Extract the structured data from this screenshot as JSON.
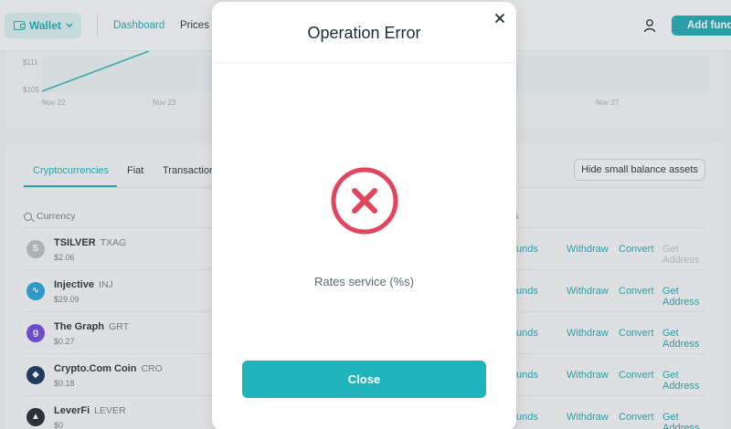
{
  "header": {
    "wallet_label": "Wallet",
    "nav": {
      "dashboard": "Dashboard",
      "prices": "Prices"
    },
    "add_funds_label": "Add funds"
  },
  "chart": {
    "y_labels": [
      "$111",
      "$105"
    ],
    "x_labels": [
      "Nov 22",
      "Nov 23",
      "Nov 27"
    ]
  },
  "assets": {
    "tabs": [
      "Cryptocurrencies",
      "Fiat",
      "Transaction"
    ],
    "hide_small_label": "Hide small balance assets",
    "currency_header": "Currency",
    "actions_header": "s",
    "rows": [
      {
        "name": "TSILVER",
        "symbol": "TXAG",
        "price": "$2.06",
        "icon_color": "#b9bdbf",
        "icon_glyph": "S",
        "actions": [
          "unds",
          "Withdraw",
          "Convert",
          "Get Address"
        ],
        "address_enabled": false
      },
      {
        "name": "Injective",
        "symbol": "INJ",
        "price": "$29.09",
        "icon_color": "#1b9fd6",
        "icon_glyph": "∿",
        "actions": [
          "unds",
          "Withdraw",
          "Convert",
          "Get Address"
        ],
        "address_enabled": true
      },
      {
        "name": "The Graph",
        "symbol": "GRT",
        "price": "$0.27",
        "icon_color": "#6c43d8",
        "icon_glyph": "g",
        "actions": [
          "unds",
          "Withdraw",
          "Convert",
          "Get Address"
        ],
        "address_enabled": true
      },
      {
        "name": "Crypto.Com Coin",
        "symbol": "CRO",
        "price": "$0.18",
        "icon_color": "#0d2b5a",
        "icon_glyph": "◆",
        "actions": [
          "unds",
          "Withdraw",
          "Convert",
          "Get Address"
        ],
        "address_enabled": true
      },
      {
        "name": "LeverFi",
        "symbol": "LEVER",
        "price": "$0",
        "icon_color": "#1c2327",
        "icon_glyph": "▲",
        "actions": [
          "unds",
          "Withdraw",
          "Convert",
          "Get Address"
        ],
        "address_enabled": true
      }
    ]
  },
  "modal": {
    "title": "Operation Error",
    "message": "Rates service (%s)",
    "close_label": "Close",
    "colors": {
      "error": "#e0475f",
      "button": "#1fb3bb"
    }
  }
}
